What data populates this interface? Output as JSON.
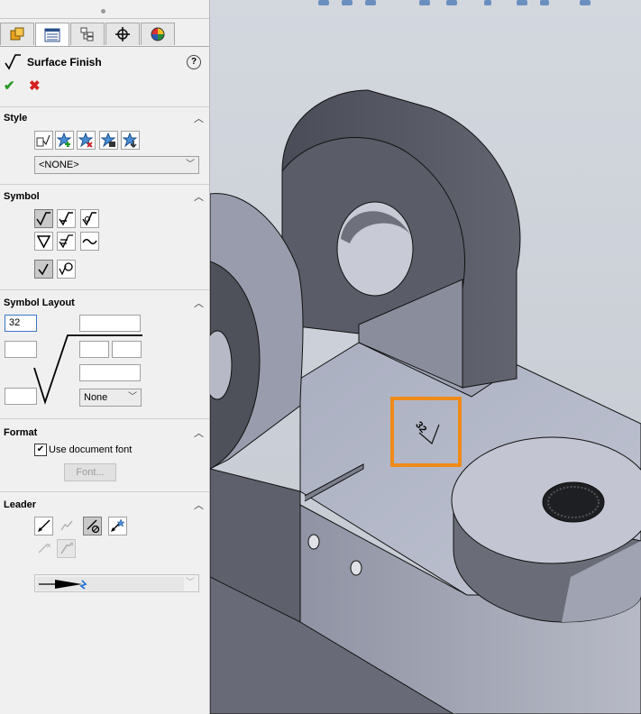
{
  "panel": {
    "title": "Surface Finish",
    "help_glyph": "?",
    "ok_glyph": "✔",
    "cancel_glyph": "✖",
    "tabs": [
      "feature-manager",
      "property-manager",
      "configuration-manager",
      "dimxpert-manager",
      "display-manager"
    ],
    "active_tab": 1
  },
  "style": {
    "header": "Style",
    "selected_style": "<NONE>"
  },
  "symbol": {
    "header": "Symbol"
  },
  "layout": {
    "header": "Symbol Layout",
    "field_value": "32",
    "lay_option": "None"
  },
  "format": {
    "header": "Format",
    "use_document_font_label": "Use document font",
    "use_document_font_checked": true,
    "check_glyph": "✔",
    "font_button_label": "Font..."
  },
  "leader": {
    "header": "Leader"
  },
  "viewport": {
    "annotation_value": "32",
    "highlight_color": "#f08a18"
  }
}
